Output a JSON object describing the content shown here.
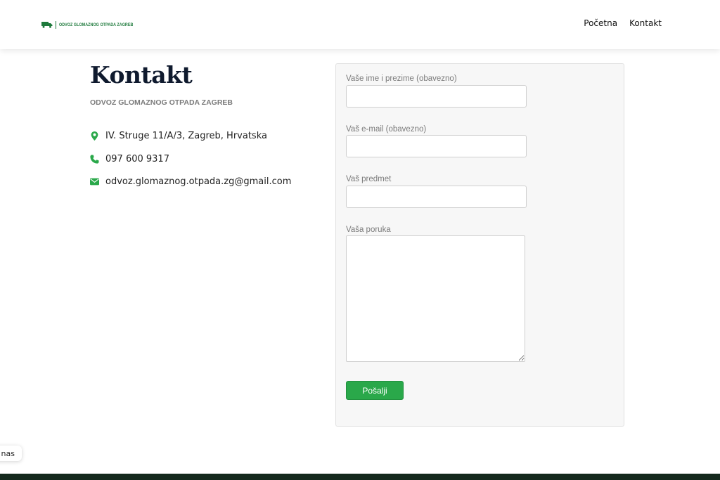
{
  "header": {
    "logo_text": "ODVOZ GLOMAZNOG OTPADA ZAGREB",
    "nav": [
      {
        "label": "Početna"
      },
      {
        "label": "Kontakt"
      }
    ]
  },
  "main": {
    "title": "Kontakt",
    "subtitle": "ODVOZ GLOMAZNOG OTPADA ZAGREB",
    "contact": {
      "address": "IV. Struge 11/A/3, Zagreb, Hrvatska",
      "phone": "097 600 9317",
      "email": "odvoz.glomaznog.otpada.zg@gmail.com"
    }
  },
  "form": {
    "name_label": "Vaše ime i prezime (obavezno)",
    "name_value": "",
    "email_label": "Vaš e-mail (obavezno)",
    "email_value": "",
    "subject_label": "Vaš predmet",
    "subject_value": "",
    "message_label": "Vaša poruka",
    "message_value": "",
    "submit_label": "Pošalji"
  },
  "float_chip": {
    "label": "nas"
  },
  "icons": {
    "logo": "truck-icon",
    "address": "map-marker-icon",
    "phone": "phone-icon",
    "email": "envelope-icon"
  },
  "colors": {
    "accent_green": "#2aa84a",
    "logo_green": "#1e7a3c",
    "title_navy": "#0f1a2e",
    "footer_dark": "#15291d"
  }
}
